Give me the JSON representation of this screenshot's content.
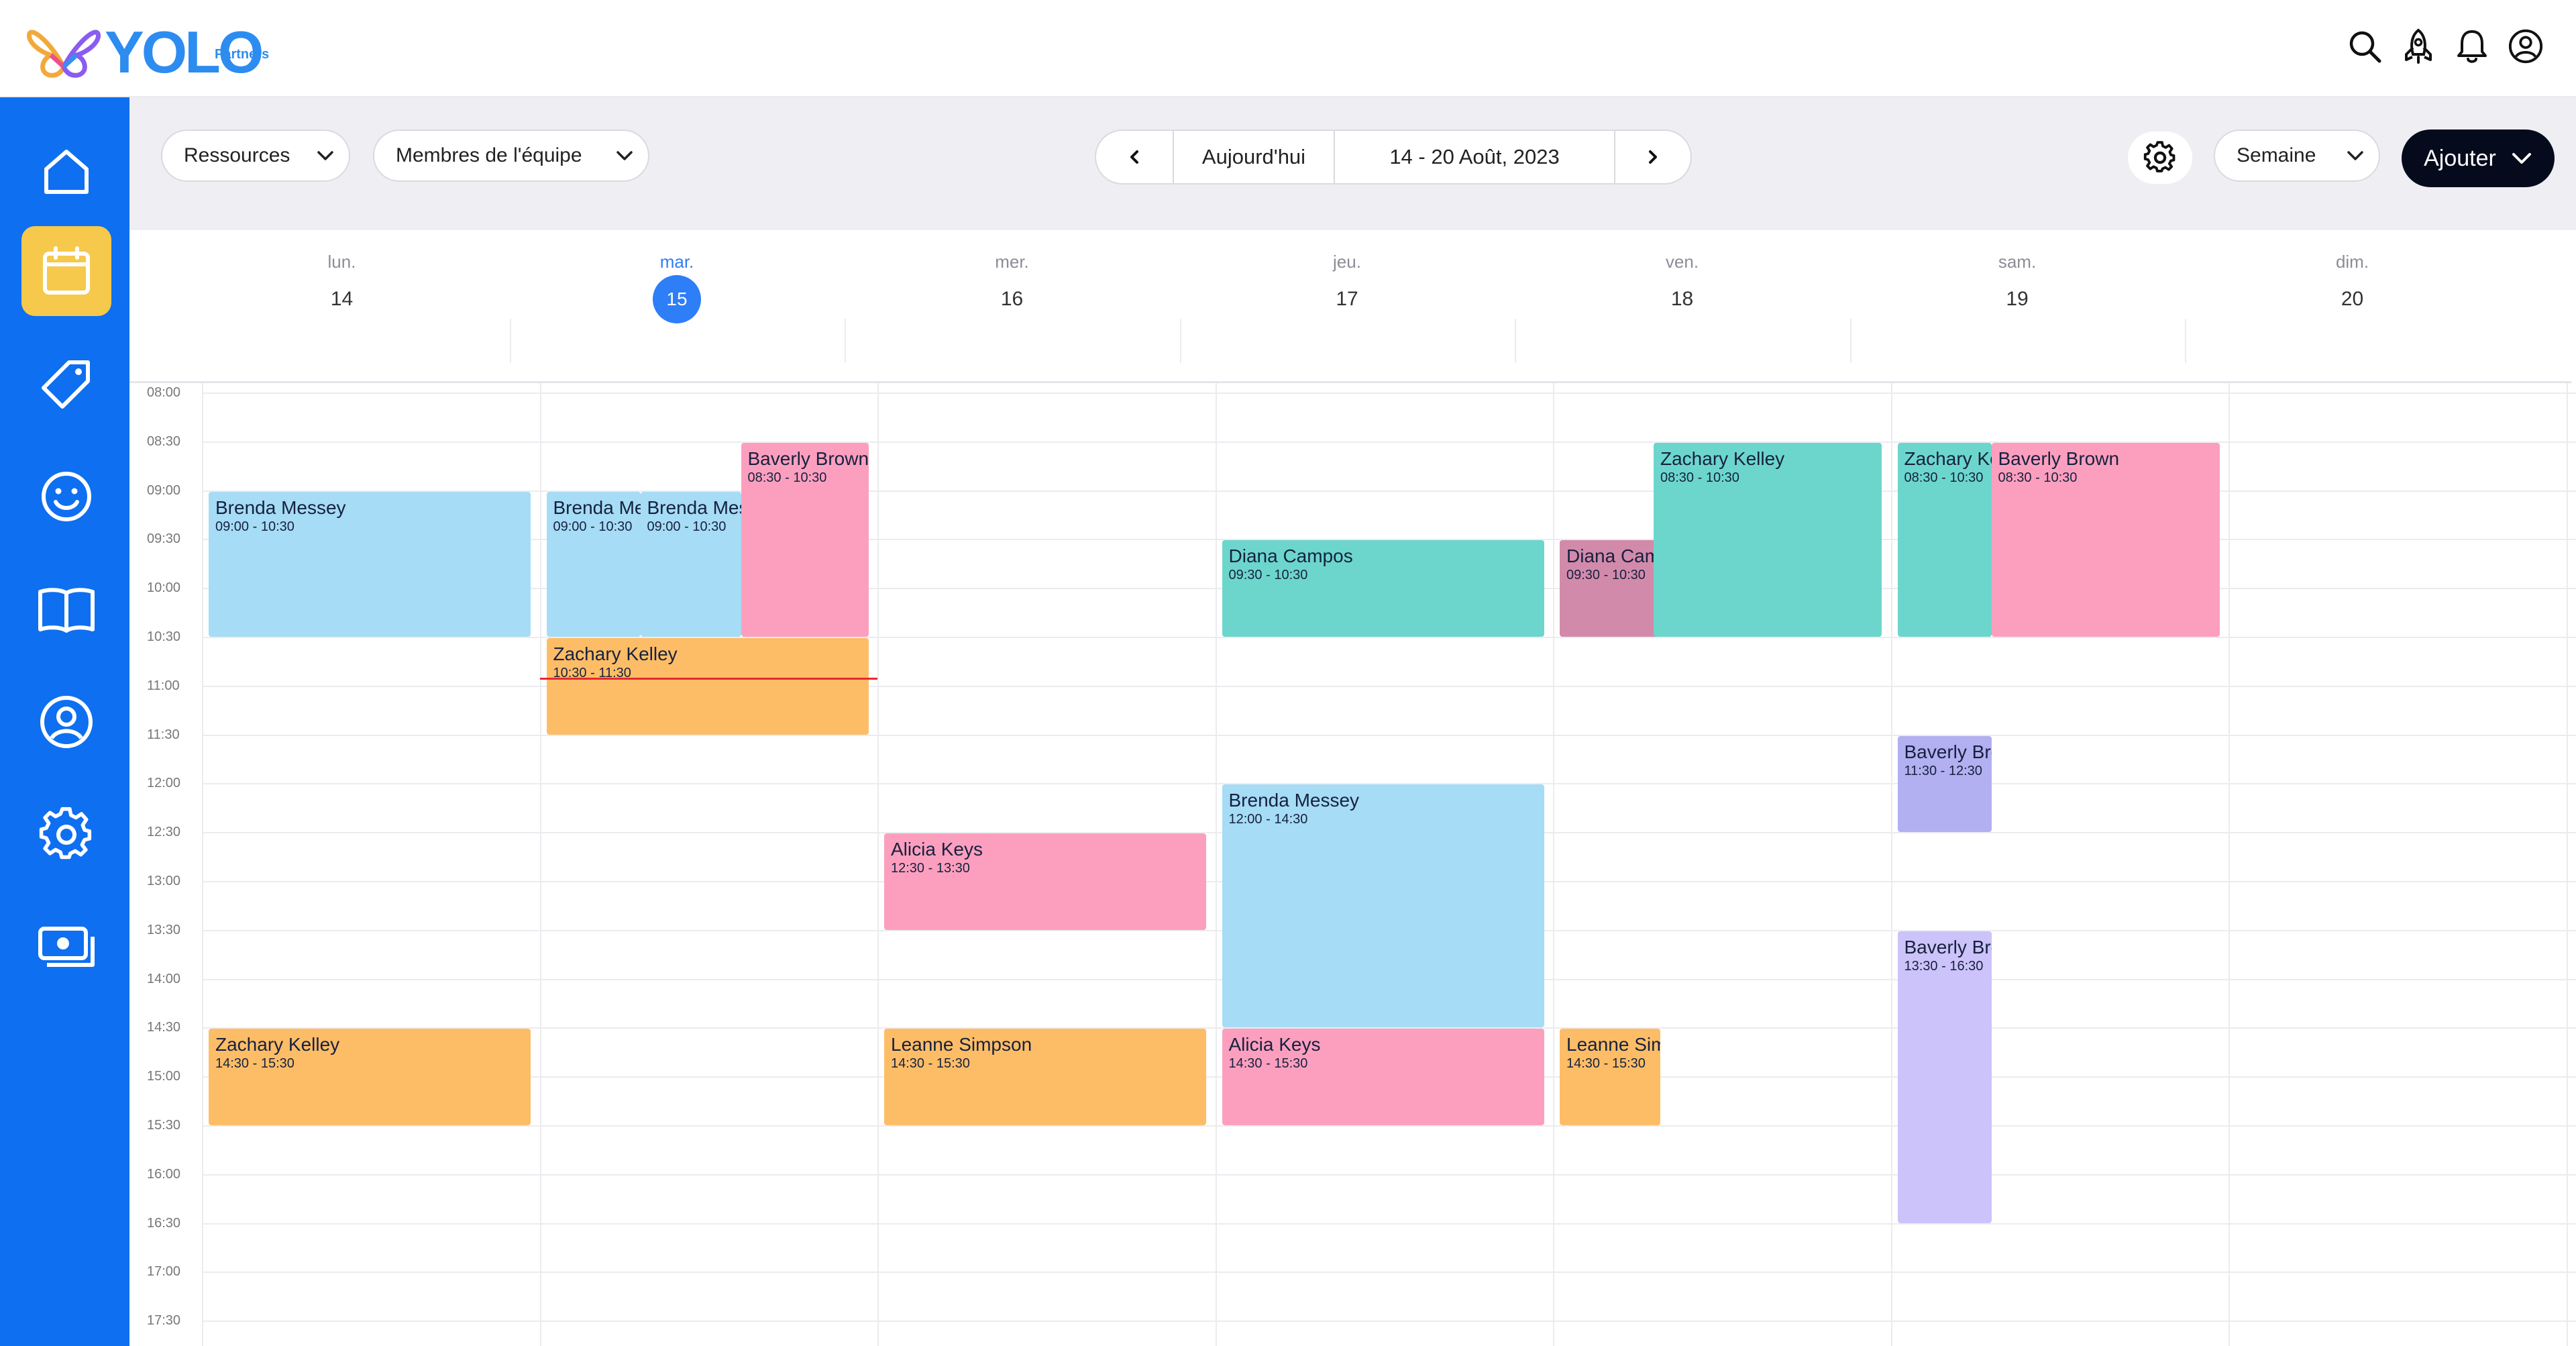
{
  "brand": {
    "name": "YOLO",
    "sub": "Partners"
  },
  "header_icons": [
    "search-icon",
    "rocket-icon",
    "bell-icon",
    "user-circle-icon"
  ],
  "sidebar": {
    "items": [
      {
        "icon": "home-icon",
        "active": false
      },
      {
        "icon": "calendar-icon",
        "active": true
      },
      {
        "icon": "tag-icon",
        "active": false
      },
      {
        "icon": "smiley-icon",
        "active": false
      },
      {
        "icon": "book-icon",
        "active": false
      },
      {
        "icon": "user-circle-icon",
        "active": false
      },
      {
        "icon": "gear-icon",
        "active": false
      },
      {
        "icon": "cash-icon",
        "active": false
      }
    ]
  },
  "toolbar": {
    "resources_label": "Ressources",
    "team_label": "Membres de l'équipe",
    "today_label": "Aujourd'hui",
    "date_range": "14 - 20 Août, 2023",
    "view_label": "Semaine",
    "add_label": "Ajouter"
  },
  "days": [
    {
      "name": "lun.",
      "date": "14",
      "today": false
    },
    {
      "name": "mar.",
      "date": "15",
      "today": true
    },
    {
      "name": "mer.",
      "date": "16",
      "today": false
    },
    {
      "name": "jeu.",
      "date": "17",
      "today": false
    },
    {
      "name": "ven.",
      "date": "18",
      "today": false
    },
    {
      "name": "sam.",
      "date": "19",
      "today": false
    },
    {
      "name": "dim.",
      "date": "20",
      "today": false
    }
  ],
  "time_labels": [
    "08:00",
    "08:30",
    "09:00",
    "09:30",
    "10:00",
    "10:30",
    "11:00",
    "11:30",
    "12:00",
    "12:30",
    "13:00",
    "13:30",
    "14:00",
    "14:30",
    "15:00",
    "15:30",
    "16:00",
    "16:30",
    "17:00",
    "17:30"
  ],
  "current_time": "10:55",
  "current_time_day": 1,
  "colors": {
    "blue": "#a6dcf5",
    "pink": "#fc9fbf",
    "orange": "#fdbd67",
    "teal": "#6cd6cd",
    "mauve": "#d28aab",
    "indigo": "#b2b0f1",
    "lilac": "#ccc3fa",
    "accent": "#0e6ff1",
    "today": "#2d7ef7"
  },
  "events": [
    {
      "day": 0,
      "col": 0,
      "cols": 1,
      "start": "09:00",
      "end": "10:30",
      "name": "Brenda Messey",
      "time": "09:00 - 10:30",
      "color": "blue"
    },
    {
      "day": 0,
      "col": 0,
      "cols": 1,
      "start": "14:30",
      "end": "15:30",
      "name": "Zachary Kelley",
      "time": "14:30 - 15:30",
      "color": "orange"
    },
    {
      "day": 1,
      "col": 0,
      "cols": 2,
      "start": "09:00",
      "end": "10:30",
      "name": "Brenda Messey",
      "time": "09:00 - 10:30",
      "color": "blue"
    },
    {
      "day": 1,
      "col": 1,
      "cols": 2,
      "start": "09:00",
      "end": "10:30",
      "name": "Brenda Messey",
      "time": "09:00 - 10:30",
      "color": "blue"
    },
    {
      "day": 1,
      "col": 2,
      "cols": 1,
      "start": "08:30",
      "end": "10:30",
      "name": "Baverly Brown",
      "time": "08:30 - 10:30",
      "color": "pink"
    },
    {
      "day": 1,
      "col": 0,
      "cols": 1,
      "start": "10:30",
      "end": "11:30",
      "name": "Zachary Kelley",
      "time": "10:30 - 11:30",
      "color": "orange"
    },
    {
      "day": 2,
      "col": 0,
      "cols": 1,
      "start": "12:30",
      "end": "13:30",
      "name": "Alicia Keys",
      "time": "12:30 - 13:30",
      "color": "pink"
    },
    {
      "day": 2,
      "col": 0,
      "cols": 1,
      "start": "14:30",
      "end": "15:30",
      "name": "Leanne Simpson",
      "time": "14:30 - 15:30",
      "color": "orange"
    },
    {
      "day": 3,
      "col": 0,
      "cols": 1,
      "start": "09:30",
      "end": "10:30",
      "name": "Diana Campos",
      "time": "09:30 - 10:30",
      "color": "teal"
    },
    {
      "day": 3,
      "col": 0,
      "cols": 1,
      "start": "12:00",
      "end": "14:30",
      "name": "Brenda Messey",
      "time": "12:00 - 14:30",
      "color": "blue"
    },
    {
      "day": 3,
      "col": 0,
      "cols": 1,
      "start": "14:30",
      "end": "15:30",
      "name": "Alicia Keys",
      "time": "14:30 - 15:30",
      "color": "pink"
    },
    {
      "day": 4,
      "col": 0,
      "cols": 1,
      "start": "09:30",
      "end": "10:30",
      "name": "Diana Campos",
      "time": "09:30 - 10:30",
      "color": "mauve"
    },
    {
      "day": 4,
      "col": 1,
      "cols": 1,
      "start": "08:30",
      "end": "10:30",
      "name": "Zachary Kelley",
      "time": "08:30 - 10:30",
      "color": "teal"
    },
    {
      "day": 4,
      "col": 0,
      "cols": 1,
      "start": "14:30",
      "end": "15:30",
      "name": "Leanne Simpson",
      "time": "14:30 - 15:30",
      "color": "orange"
    },
    {
      "day": 5,
      "col": 0,
      "cols": 1,
      "start": "08:30",
      "end": "10:30",
      "name": "Zachary Kelley",
      "time": "08:30 - 10:30",
      "color": "teal"
    },
    {
      "day": 5,
      "col": 1,
      "cols": 1,
      "start": "08:30",
      "end": "10:30",
      "name": "Baverly Brown",
      "time": "08:30 - 10:30",
      "color": "pink"
    },
    {
      "day": 5,
      "col": 0,
      "cols": 1,
      "start": "11:30",
      "end": "12:30",
      "name": "Baverly Brown",
      "time": "11:30 - 12:30",
      "color": "indigo"
    },
    {
      "day": 5,
      "col": 0,
      "cols": 1,
      "start": "13:30",
      "end": "16:30",
      "name": "Baverly Brown",
      "time": "13:30 - 16:30",
      "color": "lilac"
    }
  ]
}
